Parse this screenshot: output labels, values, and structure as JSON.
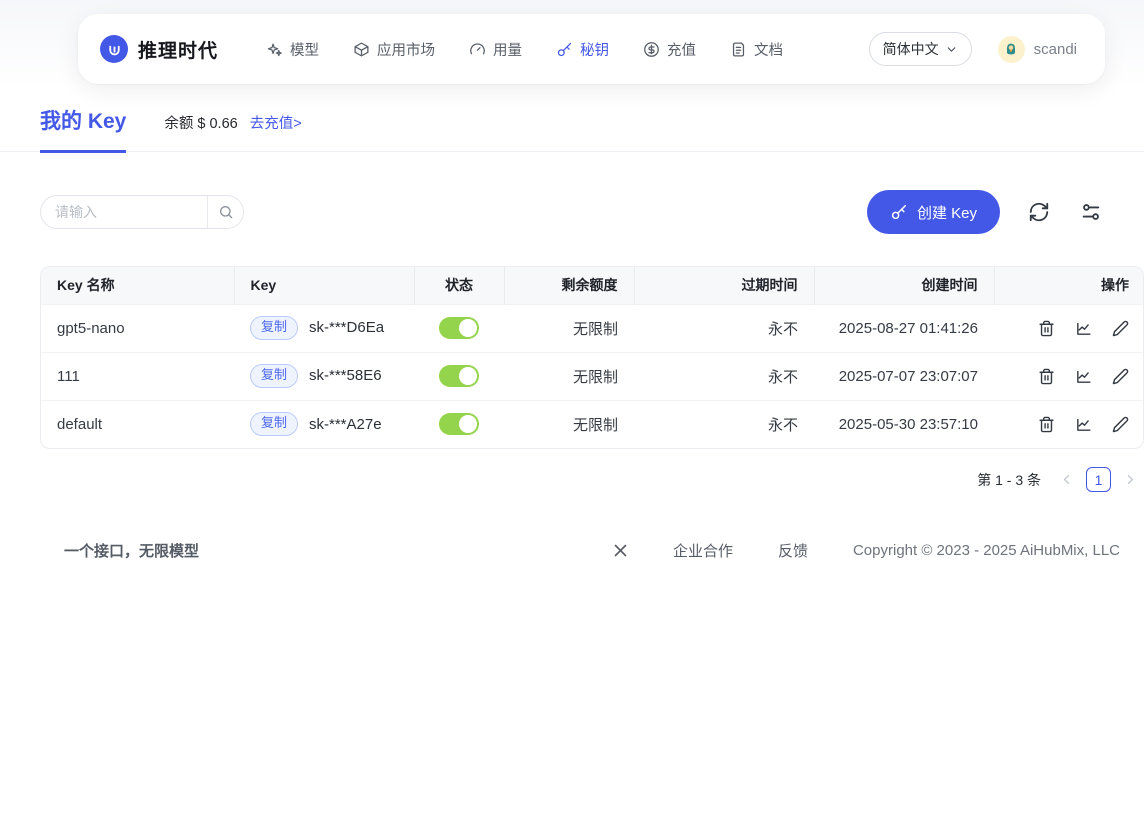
{
  "navbar": {
    "brand": "推理时代",
    "items": [
      {
        "label": "模型"
      },
      {
        "label": "应用市场"
      },
      {
        "label": "用量"
      },
      {
        "label": "秘钥"
      },
      {
        "label": "充值"
      },
      {
        "label": "文档"
      }
    ],
    "language": "简体中文",
    "username": "scandi"
  },
  "page": {
    "title": "我的 Key",
    "balance": "余额 $ 0.66",
    "recharge_link": "去充值>"
  },
  "toolbar": {
    "search_placeholder": "请输入",
    "create_button": "创建 Key"
  },
  "table": {
    "headers": [
      "Key 名称",
      "Key",
      "状态",
      "剩余额度",
      "过期时间",
      "创建时间",
      "操作"
    ],
    "copy_label": "复制",
    "rows": [
      {
        "name": "gpt5-nano",
        "key": "sk-***D6Ea",
        "status": "on",
        "quota": "无限制",
        "expires": "永不",
        "created": "2025-08-27 01:41:26"
      },
      {
        "name": "111",
        "key": "sk-***58E6",
        "status": "on",
        "quota": "无限制",
        "expires": "永不",
        "created": "2025-07-07 23:07:07"
      },
      {
        "name": "default",
        "key": "sk-***A27e",
        "status": "on",
        "quota": "无限制",
        "expires": "永不",
        "created": "2025-05-30 23:57:10"
      }
    ]
  },
  "pagination": {
    "summary": "第 1 - 3 条",
    "current_page": "1"
  },
  "footer": {
    "tagline": "一个接口，无限模型",
    "links": [
      "企业合作",
      "反馈"
    ],
    "copyright": "Copyright © 2023 - 2025 AiHubMix, LLC"
  },
  "colors": {
    "primary": "#4458e8",
    "toggle_on": "#94d44c",
    "badge_text": "#4d68f0",
    "badge_bg": "#eef3fe"
  }
}
